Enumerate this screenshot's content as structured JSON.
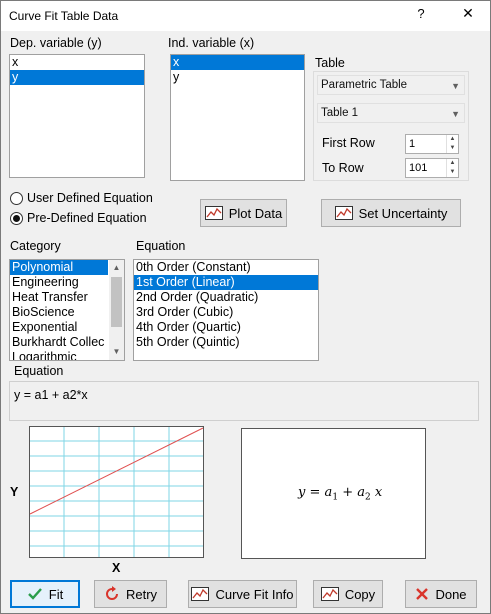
{
  "window": {
    "title": "Curve Fit Table Data",
    "help_glyph": "?",
    "close_glyph": "✕"
  },
  "dep_variable": {
    "label": "Dep. variable (y)",
    "items": [
      {
        "label": "x",
        "selected": false
      },
      {
        "label": "y",
        "selected": true
      }
    ]
  },
  "ind_variable": {
    "label": "Ind. variable (x)",
    "items": [
      {
        "label": "x",
        "selected": true
      },
      {
        "label": "y",
        "selected": false
      }
    ]
  },
  "table_group": {
    "label": "Table",
    "table_type_value": "Parametric Table",
    "table_name_value": "Table 1",
    "first_row_label": "First Row",
    "first_row_value": "1",
    "to_row_label": "To Row",
    "to_row_value": "101"
  },
  "equation_mode": {
    "user_defined_label": "User Defined Equation",
    "pre_defined_label": "Pre-Defined Equation",
    "selected": "pre_defined"
  },
  "buttons": {
    "plot_data": "Plot Data",
    "set_uncertainty": "Set Uncertainty",
    "fit": "Fit",
    "retry": "Retry",
    "curve_fit_info": "Curve Fit Info",
    "copy": "Copy",
    "done": "Done"
  },
  "category": {
    "label": "Category",
    "items": [
      {
        "label": "Polynomial",
        "selected": true
      },
      {
        "label": "Engineering",
        "selected": false
      },
      {
        "label": "Heat Transfer",
        "selected": false
      },
      {
        "label": "BioScience",
        "selected": false
      },
      {
        "label": "Exponential",
        "selected": false
      },
      {
        "label": "Burkhardt Collec",
        "selected": false
      },
      {
        "label": "Logarithmic",
        "selected": false
      }
    ]
  },
  "equation_list": {
    "label": "Equation",
    "items": [
      {
        "label": "0th Order (Constant)",
        "selected": false
      },
      {
        "label": "1st Order (Linear)",
        "selected": true
      },
      {
        "label": "2nd Order (Quadratic)",
        "selected": false
      },
      {
        "label": "3rd Order (Cubic)",
        "selected": false
      },
      {
        "label": "4th Order (Quartic)",
        "selected": false
      },
      {
        "label": "5th Order (Quintic)",
        "selected": false
      }
    ]
  },
  "equation_display": {
    "label": "Equation",
    "text": "y = a1 + a2*x"
  },
  "preview_plot": {
    "y_axis_label": "Y",
    "x_axis_label": "X",
    "grid_color": "#7fd6e6",
    "line_color": "#e05050"
  },
  "formula": {
    "y": "y",
    "eq": "=",
    "a": "a",
    "sub1": "1",
    "plus": "+",
    "sub2": "2",
    "x": "x"
  },
  "colors": {
    "selection": "#0078d7",
    "fit_icon": "#2a9d4b",
    "done_icon": "#d9342b",
    "retry_icon": "#d9342b",
    "chart_icon": "#c0392b"
  }
}
